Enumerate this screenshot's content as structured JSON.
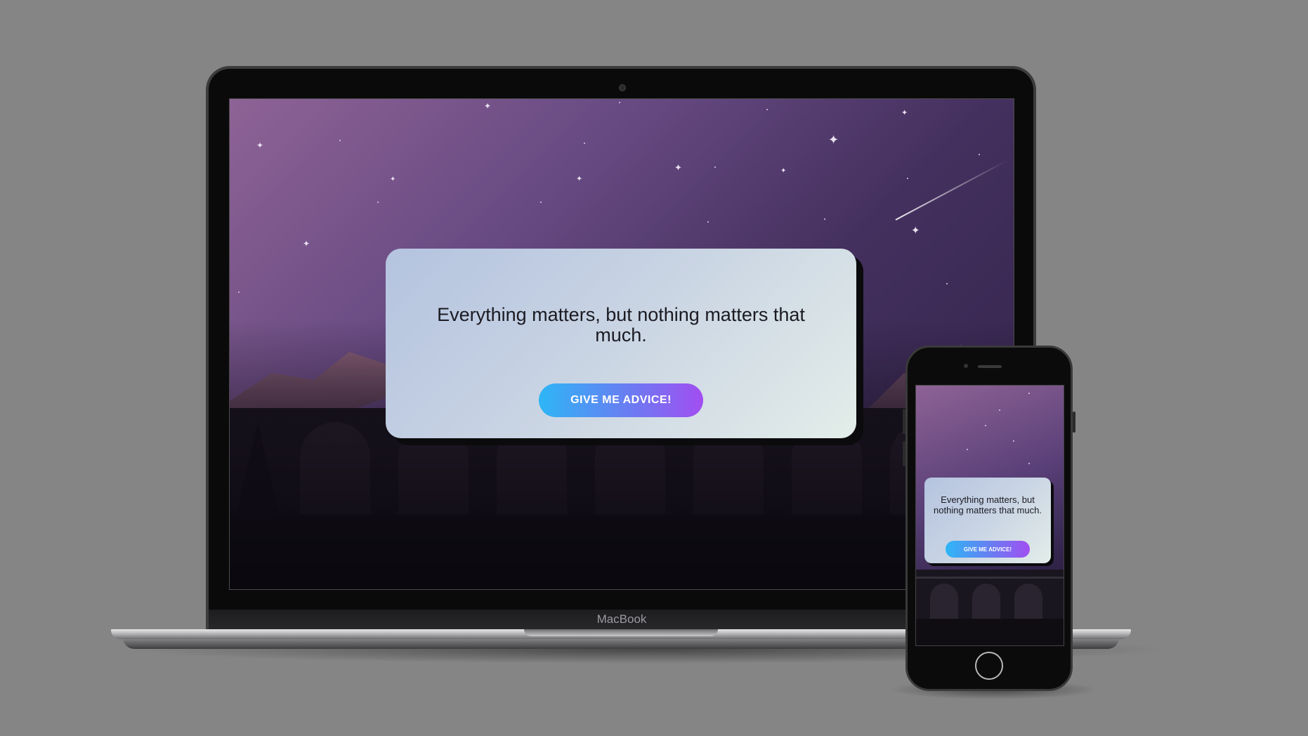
{
  "laptop": {
    "brand_label": "MacBook",
    "quote": "Everything matters, but nothing matters that much.",
    "button_label": "GIVE ME ADVICE!"
  },
  "phone": {
    "quote": "Everything matters, but nothing matters that much.",
    "button_label": "GIVE ME ADVICE!"
  },
  "colors": {
    "background": "#858585",
    "sky_top": "#8e6396",
    "sky_bottom": "#2f2248",
    "card_start": "#b4c3df",
    "card_end": "#e3ede9",
    "button_start": "#2eb6f6",
    "button_end": "#a24ef1"
  }
}
